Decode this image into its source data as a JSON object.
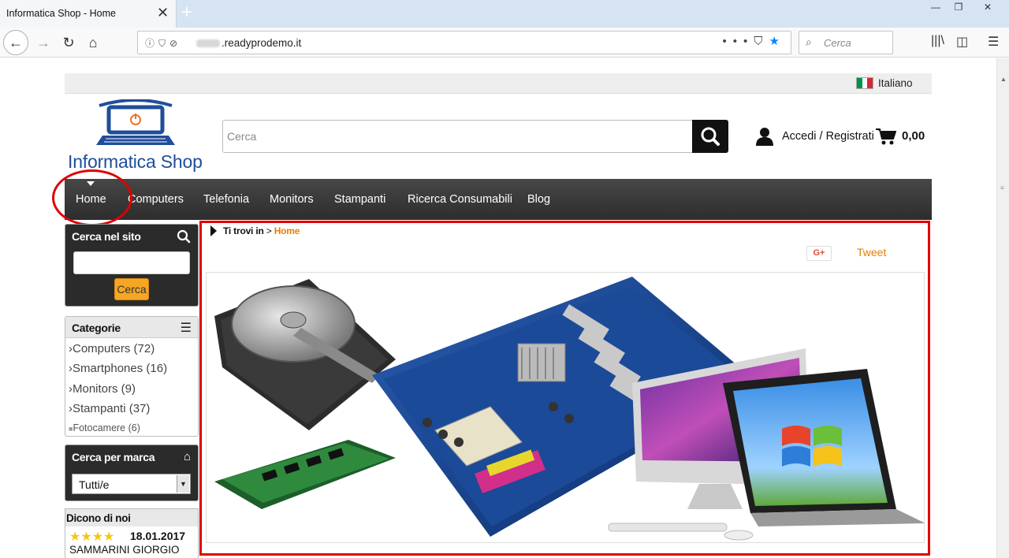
{
  "browser": {
    "tab_title": "Informatica Shop - Home",
    "url_domain": ".readyprodemo.it",
    "search_placeholder": "Cerca"
  },
  "site": {
    "language": "Italiano",
    "logo_text": "Informatica Shop",
    "search_placeholder": "Cerca",
    "account_label": "Accedi / Registrati",
    "cart_total": "0,00"
  },
  "menu": [
    "Home",
    "Computers",
    "Telefonia",
    "Monitors",
    "Stampanti",
    "Ricerca Consumabili",
    "Blog"
  ],
  "sidebar": {
    "search_title": "Cerca nel sito",
    "search_button": "Cerca",
    "categories_title": "Categorie",
    "categories": [
      "Computers (72)",
      "Smartphones (16)",
      "Monitors (9)",
      "Stampanti (37)",
      "Fotocamere (6)"
    ],
    "brand_title": "Cerca per marca",
    "brand_selected": "Tutti/e",
    "reviews_title": "Dicono di noi",
    "review_stars": "★★★★",
    "review_date": "18.01.2017",
    "review_name": "SAMMARINI GIORGIO"
  },
  "content": {
    "breadcrumb_label": "Ti trovi in",
    "breadcrumb_sep": ">",
    "breadcrumb_current": "Home",
    "gplus_label": "G+",
    "tweet_label": "Tweet"
  },
  "colors": {
    "accent_orange": "#e67e00",
    "menu_bg": "#333333",
    "annotation_red": "#e00000",
    "search_button": "#f5a623"
  }
}
